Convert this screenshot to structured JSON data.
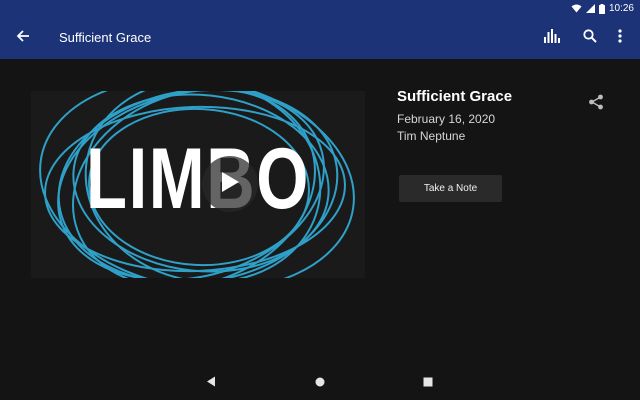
{
  "status_bar": {
    "time": "10:26"
  },
  "app_bar": {
    "title": "Sufficient Grace"
  },
  "video": {
    "artwork_text": "LIMBO"
  },
  "sermon": {
    "title": "Sufficient Grace",
    "date": "February 16, 2020",
    "speaker": "Tim Neptune"
  },
  "actions": {
    "take_note_label": "Take a Note"
  },
  "colors": {
    "app_bar": "#1c3477",
    "background": "#141414",
    "accent_rings": "#2fa0c8",
    "button": "#2a2a2a"
  },
  "icons": [
    "back-arrow-icon",
    "levels-icon",
    "search-icon",
    "more-vert-icon",
    "share-icon",
    "play-icon",
    "wifi-icon",
    "signal-icon",
    "battery-icon",
    "nav-back-icon",
    "nav-home-icon",
    "nav-recent-icon"
  ]
}
